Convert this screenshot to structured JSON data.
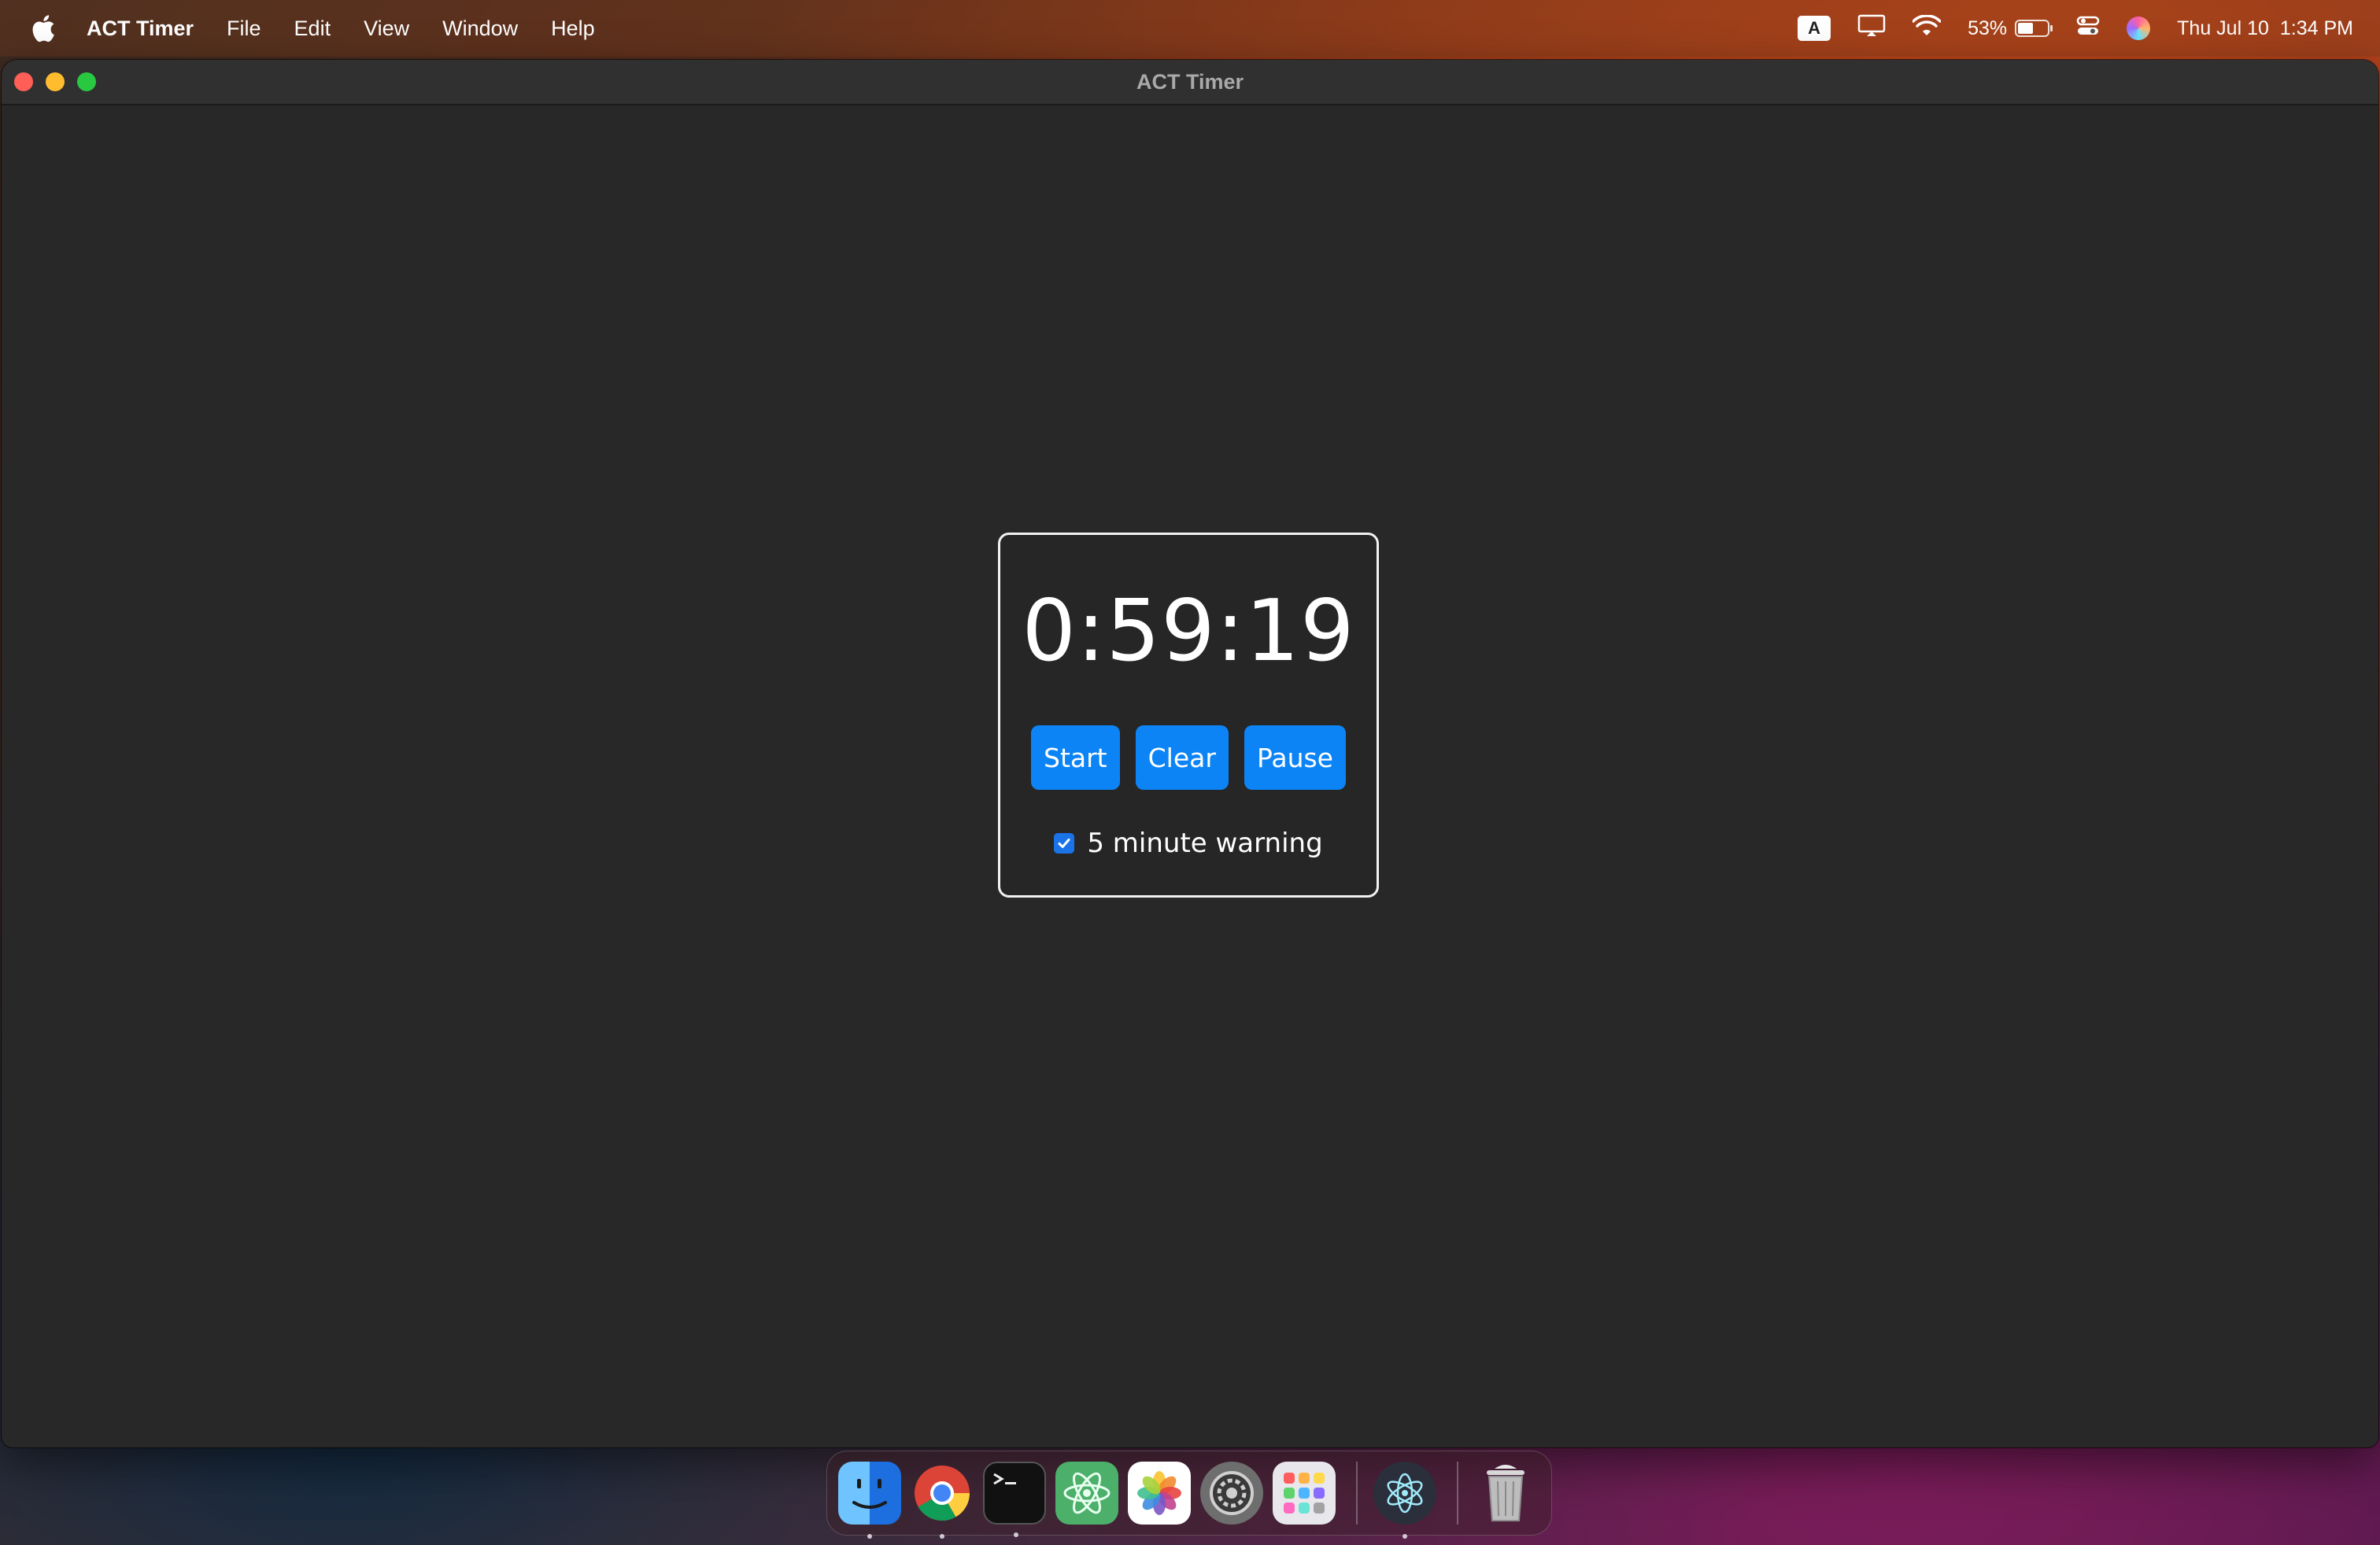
{
  "menubar": {
    "apple_icon": "apple-icon",
    "app_name": "ACT Timer",
    "menus": [
      "File",
      "Edit",
      "View",
      "Window",
      "Help"
    ],
    "status": {
      "input_source": "A",
      "battery_percent": "53%",
      "battery_level": 0.53,
      "date": "Thu Jul 10",
      "time": "1:34 PM"
    }
  },
  "window": {
    "title": "ACT Timer"
  },
  "timer": {
    "display": "0:59:19",
    "buttons": {
      "start": "Start",
      "clear": "Clear",
      "pause": "Pause"
    },
    "warning": {
      "label": "5 minute warning",
      "checked": true
    }
  },
  "colors": {
    "accent": "#0d84f5",
    "window_bg": "#282828"
  },
  "dock": {
    "apps": [
      {
        "name": "finder-icon",
        "running": true
      },
      {
        "name": "chrome-icon",
        "running": true
      },
      {
        "name": "terminal-icon",
        "running": true
      },
      {
        "name": "atom-icon",
        "running": false
      },
      {
        "name": "photos-icon",
        "running": false
      },
      {
        "name": "system-settings-icon",
        "running": false
      },
      {
        "name": "launchpad-icon",
        "running": false
      },
      {
        "name": "electron-icon",
        "running": true
      },
      {
        "name": "trash-icon",
        "running": false
      }
    ]
  }
}
